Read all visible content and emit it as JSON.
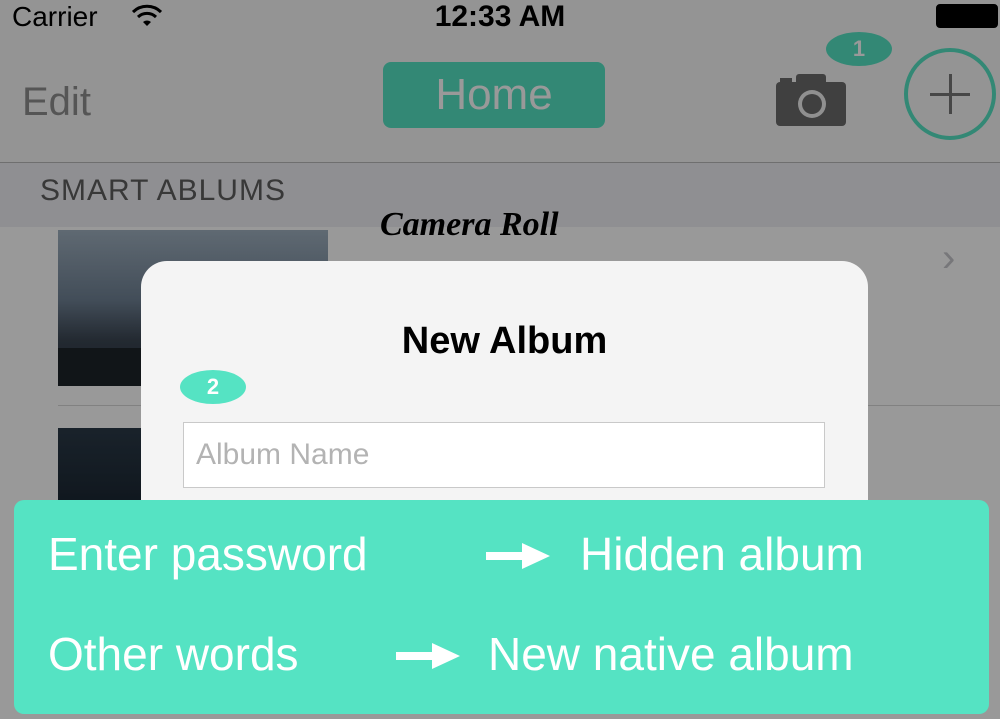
{
  "status_bar": {
    "carrier": "Carrier",
    "time": "12:33 AM",
    "wifi_icon": "wifi-icon",
    "battery_icon": "battery-icon"
  },
  "nav": {
    "edit_label": "Edit",
    "title": "Home",
    "camera_icon": "camera-icon",
    "add_icon": "plus-icon",
    "badge_1": "1"
  },
  "section": {
    "header": "SMART ABLUMS"
  },
  "list": {
    "first_item_title": "Camera Roll",
    "chevron_icon": "chevron-right-icon"
  },
  "alert": {
    "title": "New Album",
    "input_placeholder": "Album Name",
    "input_value": "",
    "badge_2": "2"
  },
  "tip": {
    "line1_left": "Enter password",
    "line1_right": "Hidden album",
    "line2_left": "Other words",
    "line2_right": "New native album",
    "arrow_icon": "arrow-right-icon"
  },
  "colors": {
    "accent": "#55e3c3",
    "dim_overlay": "rgba(0,0,0,0.40)"
  }
}
